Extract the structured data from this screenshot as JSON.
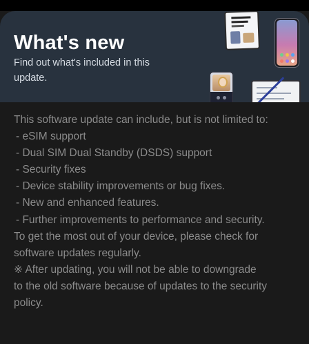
{
  "banner": {
    "title": "What's new",
    "subtitle": "Find out what's included in this update."
  },
  "content": {
    "intro": "This software update can include, but is not limited to:",
    "items": [
      "- eSIM support",
      "- Dual SIM Dual Standby (DSDS) support",
      "- Security fixes",
      "- Device stability improvements or bug fixes.",
      "- New and enhanced features.",
      "- Further improvements to performance and security."
    ],
    "advice_lines": [
      "To get the most out of your device, please check for",
      "software updates regularly."
    ],
    "warning_lines": [
      "※ After updating, you will not be able to downgrade",
      "to the old software because of updates to the security",
      "policy."
    ]
  },
  "illustration": {
    "icons": [
      "tablet-icon",
      "phone-icon",
      "foldable-phone-icon",
      "tablet-with-pen-icon"
    ]
  },
  "colors": {
    "background": "#1a1a1a",
    "banner": "#28323e",
    "title": "#ffffff",
    "subtitle": "#d5dbe2",
    "body_text": "#8b8b8b"
  }
}
